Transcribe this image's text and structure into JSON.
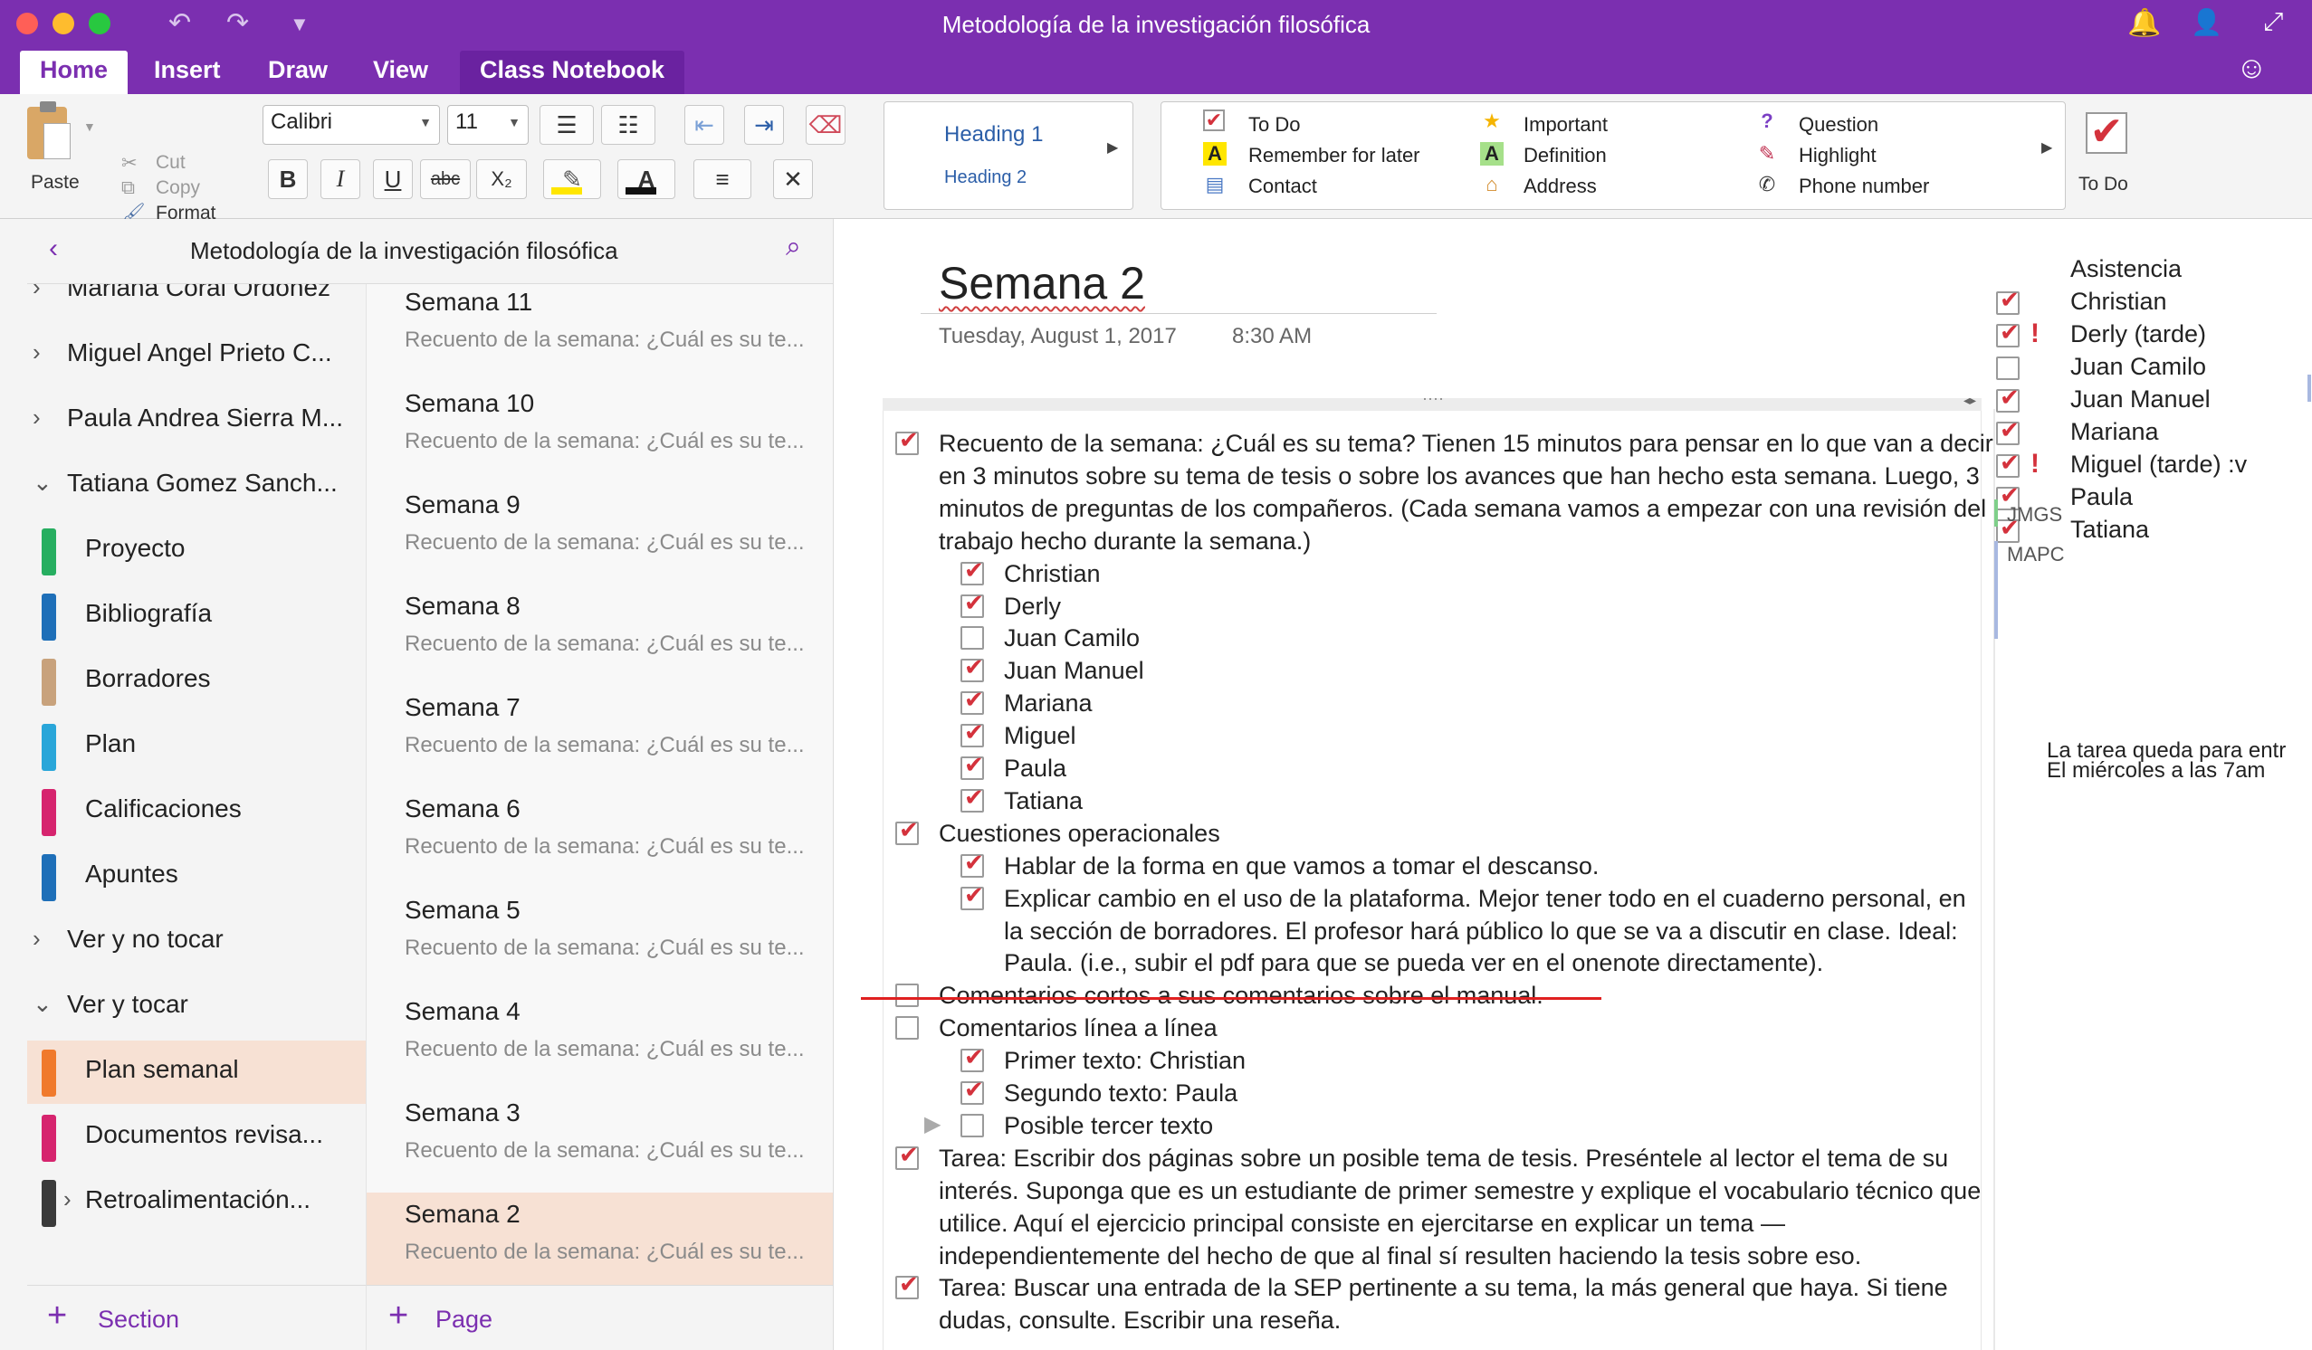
{
  "window": {
    "title": "Metodología de la investigación filosófica"
  },
  "tabs": [
    "Home",
    "Insert",
    "Draw",
    "View",
    "Class Notebook"
  ],
  "ribbon": {
    "paste": "Paste",
    "cut": "Cut",
    "copy": "Copy",
    "format": "Format",
    "font_name": "Calibri",
    "font_size": "11",
    "bold": "B",
    "italic": "I",
    "underline": "U",
    "strike": "abc",
    "subscript": "X₂",
    "styles": {
      "heading1": "Heading 1",
      "heading2": "Heading 2"
    },
    "tags": [
      {
        "label": "To Do",
        "icon": "checkbox-icon"
      },
      {
        "label": "Remember for later",
        "icon": "highlight-a-icon"
      },
      {
        "label": "Contact",
        "icon": "contact-card-icon"
      },
      {
        "label": "Important",
        "icon": "star-icon"
      },
      {
        "label": "Definition",
        "icon": "green-a-icon"
      },
      {
        "label": "Address",
        "icon": "house-icon"
      },
      {
        "label": "Question",
        "icon": "question-icon"
      },
      {
        "label": "Highlight",
        "icon": "pen-icon"
      },
      {
        "label": "Phone number",
        "icon": "phone-icon"
      }
    ],
    "todo_big": "To Do"
  },
  "nav": {
    "notebook_title": "Metodología de la investigación filosófica",
    "sections": [
      {
        "label": "Mariana Coral Ordonez",
        "type": "group",
        "expanded": false
      },
      {
        "label": "Miguel Angel Prieto C...",
        "type": "group",
        "expanded": false
      },
      {
        "label": "Paula Andrea Sierra M...",
        "type": "group",
        "expanded": false
      },
      {
        "label": "Tatiana Gomez Sanch...",
        "type": "group",
        "expanded": true
      },
      {
        "label": "Proyecto",
        "type": "section",
        "color": "#27ae60"
      },
      {
        "label": "Bibliografía",
        "type": "section",
        "color": "#1e6fb8"
      },
      {
        "label": "Borradores",
        "type": "section",
        "color": "#c8a27c"
      },
      {
        "label": "Plan",
        "type": "section",
        "color": "#29a6d9"
      },
      {
        "label": "Calificaciones",
        "type": "section",
        "color": "#d6246e"
      },
      {
        "label": "Apuntes",
        "type": "section",
        "color": "#1e6fb8"
      },
      {
        "label": "Ver y no tocar",
        "type": "group",
        "expanded": false
      },
      {
        "label": "Ver y tocar",
        "type": "group",
        "expanded": true
      },
      {
        "label": "Plan semanal",
        "type": "section",
        "color": "#f07a2c",
        "selected": true
      },
      {
        "label": "Documentos revisa...",
        "type": "section",
        "color": "#d6246e"
      },
      {
        "label": "Retroalimentación...",
        "type": "subgroup",
        "color": "#3a3a3a"
      }
    ],
    "pages": [
      {
        "title": "Semana 11",
        "preview": "Recuento de la semana: ¿Cuál es su te..."
      },
      {
        "title": "Semana 10",
        "preview": "Recuento de la semana: ¿Cuál es su te..."
      },
      {
        "title": "Semana 9",
        "preview": "Recuento de la semana: ¿Cuál es su te..."
      },
      {
        "title": "Semana 8",
        "preview": "Recuento de la semana: ¿Cuál es su te..."
      },
      {
        "title": "Semana 7",
        "preview": "Recuento de la semana: ¿Cuál es su te..."
      },
      {
        "title": "Semana 6",
        "preview": "Recuento de la semana: ¿Cuál es su te..."
      },
      {
        "title": "Semana 5",
        "preview": "Recuento de la semana: ¿Cuál es su te..."
      },
      {
        "title": "Semana 4",
        "preview": "Recuento de la semana: ¿Cuál es su te..."
      },
      {
        "title": "Semana 3",
        "preview": "Recuento de la semana: ¿Cuál es su te..."
      },
      {
        "title": "Semana 2",
        "preview": "Recuento de la semana: ¿Cuál es su te...",
        "selected": true
      }
    ],
    "add_section": "Section",
    "add_page": "Page"
  },
  "page": {
    "title": "Semana 2",
    "date": "Tuesday, August 1, 2017",
    "time": "8:30 AM",
    "lines": [
      {
        "text": "Recuento de la semana: ¿Cuál es su tema?  Tienen 15 minutos para pensar en lo que van a decir",
        "indent": 0,
        "check": true
      },
      {
        "text": "en 3 minutos sobre su tema de tesis o sobre los avances que han hecho esta semana. Luego, 3",
        "indent": 0
      },
      {
        "text": "minutos de preguntas de los compañeros. (Cada semana vamos a empezar con una revisión del",
        "indent": 0
      },
      {
        "text": "trabajo hecho durante la semana.)",
        "indent": 0
      },
      {
        "text": "Christian",
        "indent": 1,
        "check": true
      },
      {
        "text": "Derly",
        "indent": 1,
        "check": true
      },
      {
        "text": "Juan Camilo",
        "indent": 1,
        "check": false
      },
      {
        "text": "Juan Manuel",
        "indent": 1,
        "check": true
      },
      {
        "text": "Mariana",
        "indent": 1,
        "check": true
      },
      {
        "text": "Miguel",
        "indent": 1,
        "check": true
      },
      {
        "text": "Paula",
        "indent": 1,
        "check": true
      },
      {
        "text": "Tatiana",
        "indent": 1,
        "check": true
      },
      {
        "text": "Cuestiones operacionales",
        "indent": 0,
        "check": true
      },
      {
        "text": "Hablar de la forma en que vamos a tomar el descanso.",
        "indent": 1,
        "check": true
      },
      {
        "text": "Explicar  cambio en el uso de la plataforma. Mejor tener todo en el cuaderno personal, en",
        "indent": 1,
        "check": true
      },
      {
        "text": "la sección de borradores. El profesor hará público lo que se va a discutir en clase.  Ideal:",
        "indent": 1
      },
      {
        "text": "Paula. (i.e., subir el pdf para que se pueda ver en el onenote directamente).",
        "indent": 1
      },
      {
        "text": "Comentarios cortos a sus comentarios sobre el manual.",
        "indent": 0,
        "check": false,
        "struck": true
      },
      {
        "text": "Comentarios línea a línea",
        "indent": 0,
        "check": false
      },
      {
        "text": "Primer texto: Christian",
        "indent": 1,
        "check": true
      },
      {
        "text": "Segundo texto: Paula",
        "indent": 1,
        "check": true
      },
      {
        "text": "Posible tercer texto",
        "indent": 1,
        "check": false
      },
      {
        "text": "Tarea:  Escribir dos páginas sobre un posible tema de tesis. Preséntele al lector el tema de su",
        "indent": 0,
        "check": true
      },
      {
        "text": "interés. Suponga que es un estudiante de primer semestre y explique el vocabulario técnico que",
        "indent": 0
      },
      {
        "text": "utilice. Aquí el ejercicio principal consiste en ejercitarse  en explicar  un tema —",
        "indent": 0
      },
      {
        "text": "independientemente del hecho de que al final sí resulten haciendo la tesis sobre eso.",
        "indent": 0
      },
      {
        "text": "Tarea: Buscar una entrada de la SEP pertinente a su tema, la más general que haya. Si tiene",
        "indent": 0,
        "check": true
      },
      {
        "text": "dudas, consulte. Escribir una reseña.",
        "indent": 0
      }
    ],
    "attendance": {
      "title": "Asistencia",
      "entries": [
        {
          "name": "Christian",
          "check": true,
          "flag": false
        },
        {
          "name": "Derly (tarde)",
          "check": true,
          "flag": true
        },
        {
          "name": "Juan Camilo",
          "check": false,
          "flag": false
        },
        {
          "name": "Juan Manuel",
          "check": true,
          "flag": false
        },
        {
          "name": "Mariana",
          "check": true,
          "flag": false
        },
        {
          "name": "Miguel (tarde) :v",
          "check": true,
          "flag": true
        },
        {
          "name": "Paula",
          "check": true,
          "flag": false
        },
        {
          "name": "Tatiana",
          "check": true,
          "flag": false
        }
      ]
    },
    "authors": [
      "JMGS",
      "MAPC"
    ],
    "side_note": [
      "La tarea queda para entr",
      "El miércoles a las 7am"
    ]
  }
}
